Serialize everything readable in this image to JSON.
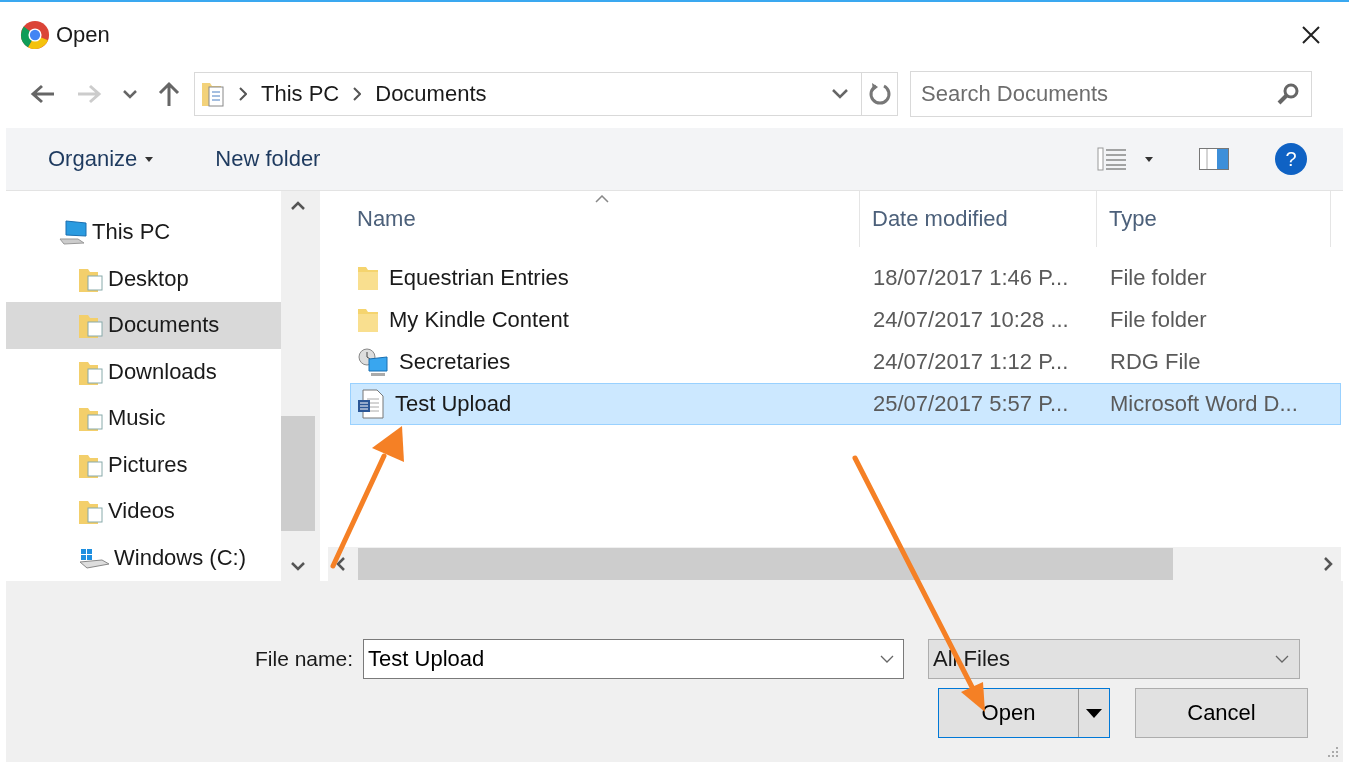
{
  "window": {
    "title": "Open"
  },
  "nav": {
    "back_disabled": false,
    "forward_disabled": true,
    "breadcrumb": [
      "This PC",
      "Documents"
    ],
    "search": {
      "placeholder": "Search Documents"
    }
  },
  "toolbar": {
    "organize": "Organize",
    "new_folder": "New folder",
    "help": "?"
  },
  "sidebar": {
    "items": [
      {
        "label": "This PC",
        "kind": "computer",
        "selected": false,
        "children": [
          {
            "label": "Desktop",
            "kind": "folder",
            "selected": false
          },
          {
            "label": "Documents",
            "kind": "folder",
            "selected": true
          },
          {
            "label": "Downloads",
            "kind": "folder",
            "selected": false
          },
          {
            "label": "Music",
            "kind": "folder",
            "selected": false
          },
          {
            "label": "Pictures",
            "kind": "folder",
            "selected": false
          },
          {
            "label": "Videos",
            "kind": "folder",
            "selected": false
          },
          {
            "label": "Windows (C:)",
            "kind": "drive",
            "selected": false
          }
        ]
      }
    ]
  },
  "table": {
    "columns": [
      "Name",
      "Date modified",
      "Type"
    ],
    "rows": [
      {
        "name": "Equestrian Entries",
        "kind": "folder",
        "date": "18/07/2017 1:46 P...",
        "type": "File folder",
        "selected": false
      },
      {
        "name": "My Kindle Content",
        "kind": "folder",
        "date": "24/07/2017 10:28 ...",
        "type": "File folder",
        "selected": false
      },
      {
        "name": "Secretaries",
        "kind": "rdg",
        "date": "24/07/2017 1:12 P...",
        "type": "RDG File",
        "selected": false
      },
      {
        "name": "Test Upload",
        "kind": "word",
        "date": "25/07/2017 5:57 P...",
        "type": "Microsoft Word D...",
        "selected": true
      }
    ]
  },
  "footer": {
    "file_name_label": "File name:",
    "file_name": "Test Upload",
    "file_type": "All Files",
    "open": "Open",
    "cancel": "Cancel"
  }
}
